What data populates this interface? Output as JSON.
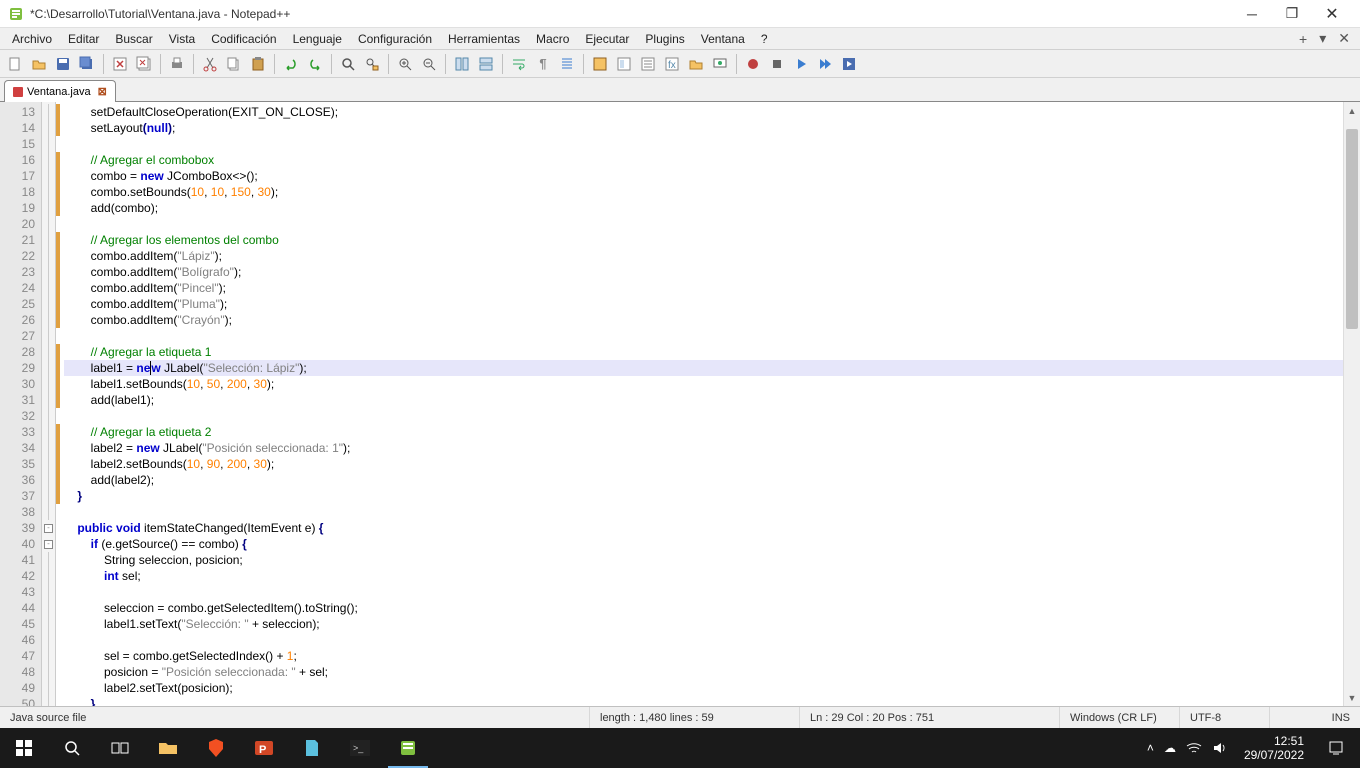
{
  "window": {
    "title": "*C:\\Desarrollo\\Tutorial\\Ventana.java - Notepad++"
  },
  "menu": {
    "items": [
      "Archivo",
      "Editar",
      "Buscar",
      "Vista",
      "Codificación",
      "Lenguaje",
      "Configuración",
      "Herramientas",
      "Macro",
      "Ejecutar",
      "Plugins",
      "Ventana",
      "?"
    ]
  },
  "tab": {
    "name": "Ventana.java"
  },
  "lines": {
    "start": 13,
    "end": 50
  },
  "code": {
    "l13": "setDefaultCloseOperation(EXIT_ON_CLOSE);",
    "l14": "setLayout",
    "l14b": "null",
    "l16c": "// Agregar el combobox",
    "l17a": "combo = ",
    "l17k": "new",
    "l17b": " JComboBox<>();",
    "l18a": "combo.setBounds(",
    "l18n1": "10",
    "l18n2": "10",
    "l18n3": "150",
    "l18n4": "30",
    "l19": "add(combo);",
    "l21c": "// Agregar los elementos del combo",
    "l22": "combo.addItem(",
    "l22s": "\"Lápiz\"",
    "l23": "combo.addItem(",
    "l23s": "\"Bolígrafo\"",
    "l24": "combo.addItem(",
    "l24s": "\"Pincel\"",
    "l25": "combo.addItem(",
    "l25s": "\"Pluma\"",
    "l26": "combo.addItem(",
    "l26s": "\"Crayón\"",
    "l28c": "// Agregar la etiqueta 1",
    "l29a": "label1 = ",
    "l29k": "new",
    "l29b": " JLabel(",
    "l29s": "\"Selección: Lápiz\"",
    "l30a": "label1.setBounds(",
    "l30n1": "10",
    "l30n2": "50",
    "l30n3": "200",
    "l30n4": "30",
    "l31": "add(label1);",
    "l33c": "// Agregar la etiqueta 2",
    "l34a": "label2 = ",
    "l34k": "new",
    "l34b": " JLabel(",
    "l34s": "\"Posición seleccionada: 1\"",
    "l35a": "label2.setBounds(",
    "l35n1": "10",
    "l35n2": "90",
    "l35n3": "200",
    "l35n4": "30",
    "l36": "add(label2);",
    "l39k1": "public",
    "l39k2": "void",
    "l39a": " itemStateChanged(ItemEvent e) ",
    "l40k": "if",
    "l40a": " (e.getSource() == combo) ",
    "l41a": "String seleccion, posicion;",
    "l42k": "int",
    "l42a": " sel;",
    "l44a": "seleccion = combo.getSelectedItem().toString();",
    "l45a": "label1.setText(",
    "l45s": "\"Selección: \"",
    "l45b": " + seleccion);",
    "l47a": "sel = combo.getSelectedIndex() + ",
    "l47n": "1",
    "l48a": "posicion = ",
    "l48s": "\"Posición seleccionada: \"",
    "l48b": " + sel;",
    "l49a": "label2.setText(posicion);"
  },
  "status": {
    "filetype": "Java source file",
    "length": "length : 1,480    lines : 59",
    "pos": "Ln : 29    Col : 20    Pos : 751",
    "eol": "Windows (CR LF)",
    "enc": "UTF-8",
    "ins": "INS"
  },
  "clock": {
    "time": "12:51",
    "date": "29/07/2022"
  }
}
